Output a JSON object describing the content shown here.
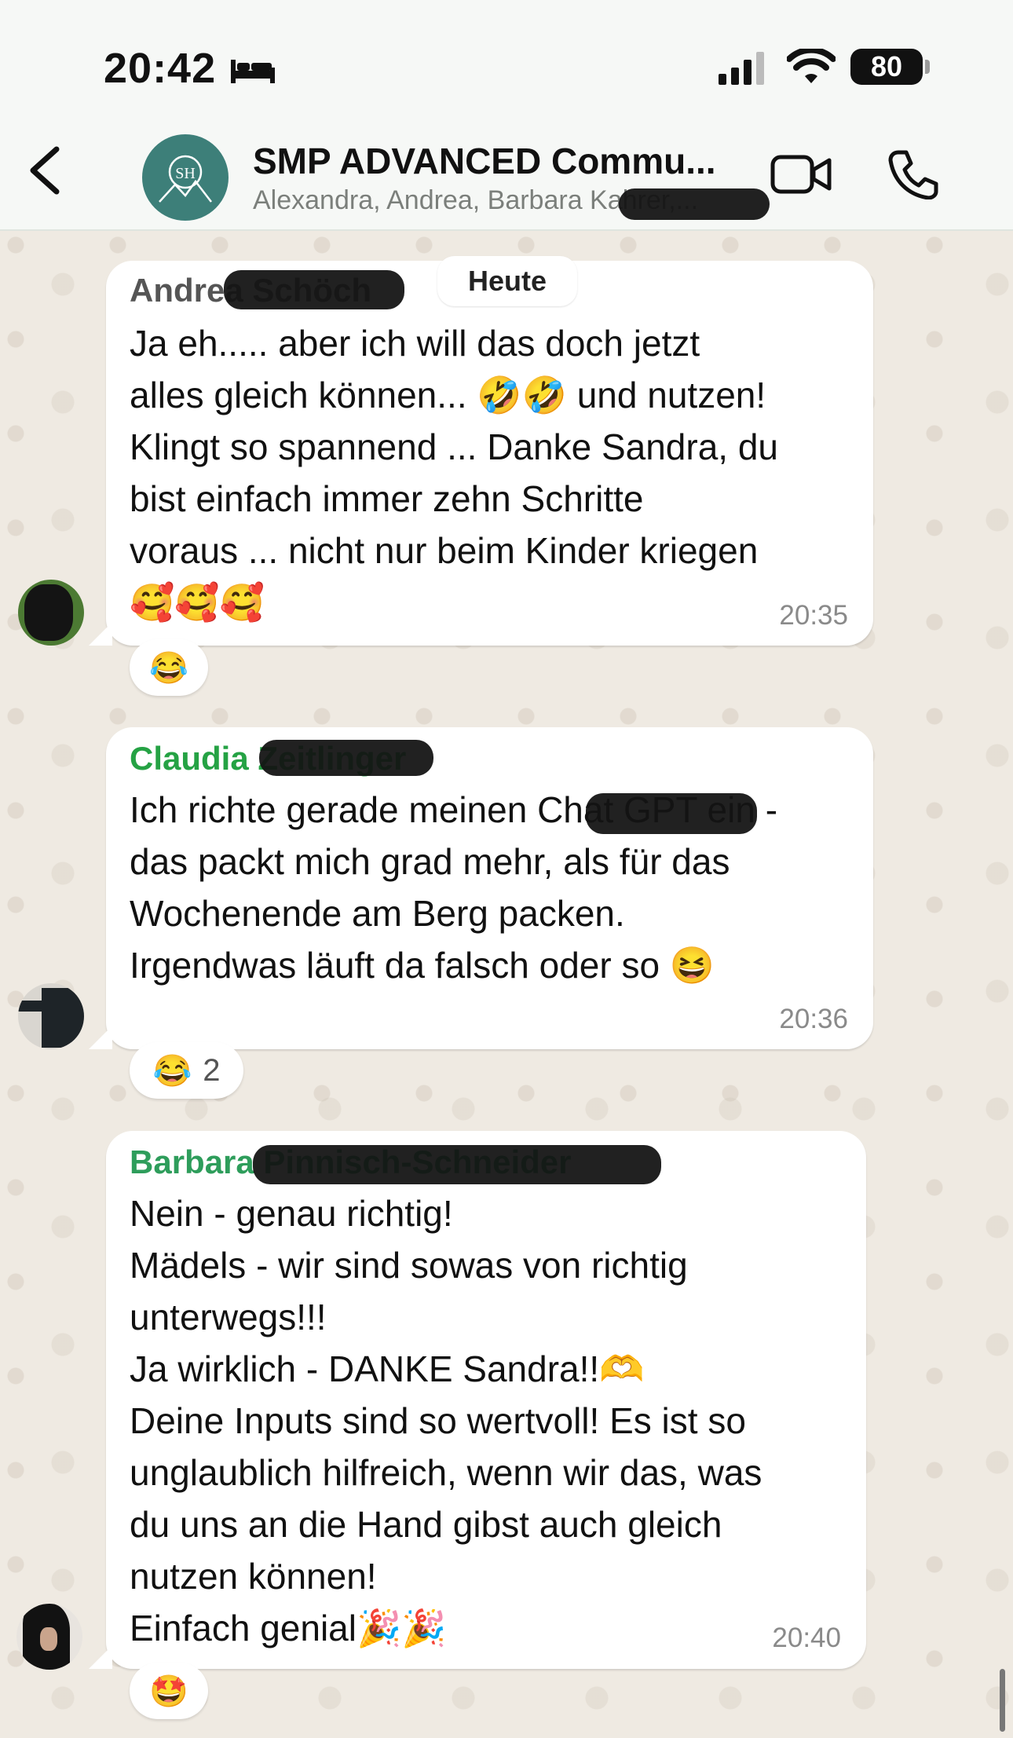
{
  "status_bar": {
    "time": "20:42",
    "battery": "80"
  },
  "header": {
    "chat_title": "SMP ADVANCED Commu...",
    "members": "Alexandra, Andrea, Barbara Kahrer,..."
  },
  "date_divider": "Heute",
  "messages": [
    {
      "sender": "Andrea Schöch",
      "sender_color": "#555555",
      "text": "Ja eh..... aber ich will das doch jetzt\nalles gleich können... 🤣🤣 und nutzen!\nKlingt so spannend ... Danke Sandra, du\nbist einfach immer zehn Schritte\nvoraus ... nicht nur beim Kinder kriegen\n🥰🥰🥰",
      "time": "20:35",
      "reaction": {
        "emoji": "😂",
        "count": ""
      }
    },
    {
      "sender": "Claudia Zeitlinger",
      "sender_color": "#25a244",
      "text": "Ich richte gerade meinen Chat GPT ein -\ndas packt mich grad mehr, als für das\nWochenende am Berg packen.\nIrgendwas läuft da falsch oder so 😆",
      "time": "20:36",
      "reaction": {
        "emoji": "😂",
        "count": "2"
      }
    },
    {
      "sender": "Barbara Pinnisch-Schneider",
      "sender_color": "#2e9d5b",
      "text": "Nein - genau richtig!\nMädels - wir sind sowas von richtig\nunterwegs!!!\nJa wirklich - DANKE Sandra!!🫶\nDeine Inputs sind so wertvoll! Es ist so\nunglaublich hilfreich, wenn wir das, was\ndu uns an die Hand gibst auch gleich\nnutzen können!\nEinfach genial🎉🎉",
      "time": "20:40",
      "reaction": {
        "emoji": "🤩",
        "count": ""
      }
    }
  ]
}
